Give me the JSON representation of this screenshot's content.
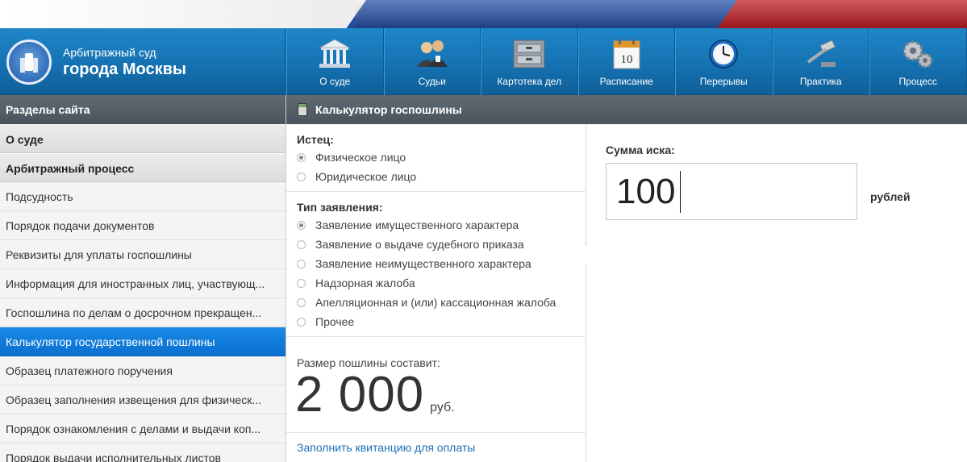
{
  "header": {
    "court_line1": "Арбитражный суд",
    "court_line2": "города Москвы"
  },
  "nav": {
    "items": [
      {
        "label": "О суде",
        "icon": "courthouse-icon"
      },
      {
        "label": "Судьи",
        "icon": "judges-icon"
      },
      {
        "label": "Картотека дел",
        "icon": "file-cabinet-icon"
      },
      {
        "label": "Расписание",
        "icon": "calendar-icon",
        "calendar_day": "10"
      },
      {
        "label": "Перерывы",
        "icon": "clock-icon"
      },
      {
        "label": "Практика",
        "icon": "gavel-icon"
      },
      {
        "label": "Процесс",
        "icon": "gears-icon"
      }
    ]
  },
  "sidebar": {
    "heading": "Разделы сайта",
    "categories": [
      "О суде",
      "Арбитражный процесс"
    ],
    "items": [
      {
        "label": "Подсудность",
        "active": false
      },
      {
        "label": "Порядок подачи документов",
        "active": false
      },
      {
        "label": "Реквизиты для уплаты госпошлины",
        "active": false
      },
      {
        "label": "Информация для иностранных лиц, участвующ...",
        "active": false
      },
      {
        "label": "Госпошлина по делам о досрочном прекращен...",
        "active": false
      },
      {
        "label": "Калькулятор государственной пошлины",
        "active": true
      },
      {
        "label": "Образец платежного поручения",
        "active": false
      },
      {
        "label": "Образец заполнения извещения для физическ...",
        "active": false
      },
      {
        "label": "Порядок ознакомления с делами и выдачи коп...",
        "active": false
      },
      {
        "label": "Порядок выдачи исполнительных листов",
        "active": false
      }
    ]
  },
  "calculator": {
    "heading": "Калькулятор госпошлины",
    "plaintiff": {
      "title": "Истец:",
      "options": [
        {
          "label": "Физическое лицо",
          "selected": true
        },
        {
          "label": "Юридическое лицо",
          "selected": false
        }
      ]
    },
    "claim_type": {
      "title": "Тип заявления:",
      "options": [
        {
          "label": "Заявление имущественного характера",
          "selected": true
        },
        {
          "label": "Заявление о выдаче судебного приказа",
          "selected": false
        },
        {
          "label": "Заявление неимущественного характера",
          "selected": false
        },
        {
          "label": "Надзорная жалоба",
          "selected": false
        },
        {
          "label": "Апелляционная и (или) кассационная жалоба",
          "selected": false
        },
        {
          "label": "Прочее",
          "selected": false
        }
      ]
    },
    "fee_label": "Размер пошлины составит:",
    "fee_value": "2 000",
    "fee_unit": "руб.",
    "fill_link": "Заполнить квитанцию для оплаты",
    "sum_label": "Сумма иска:",
    "sum_value": "100",
    "sum_unit": "рублей"
  },
  "colors": {
    "header_blue": "#1572b2",
    "active_blue": "#0a6fd0",
    "link_blue": "#1f6fb5"
  }
}
